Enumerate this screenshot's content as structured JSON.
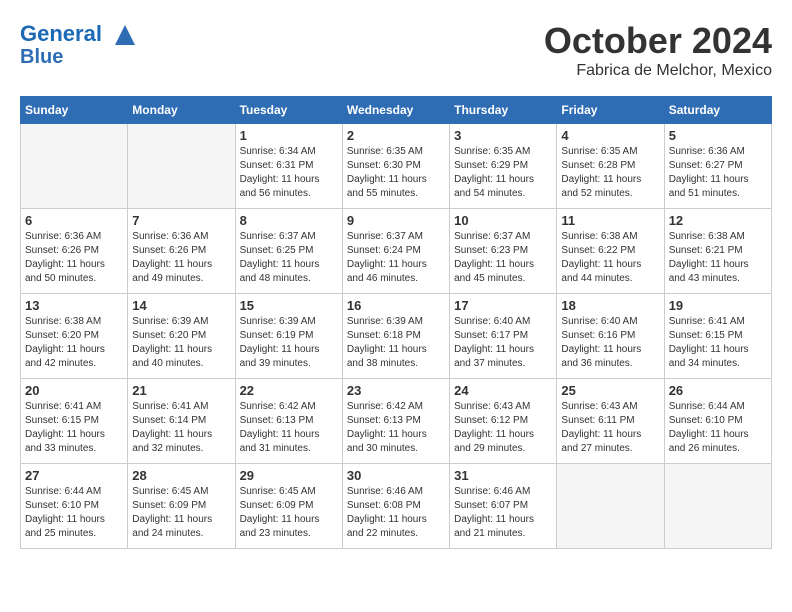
{
  "header": {
    "logo_line1": "General",
    "logo_line2": "Blue",
    "month": "October 2024",
    "location": "Fabrica de Melchor, Mexico"
  },
  "weekdays": [
    "Sunday",
    "Monday",
    "Tuesday",
    "Wednesday",
    "Thursday",
    "Friday",
    "Saturday"
  ],
  "weeks": [
    [
      {
        "day": "",
        "info": ""
      },
      {
        "day": "",
        "info": ""
      },
      {
        "day": "1",
        "info": "Sunrise: 6:34 AM\nSunset: 6:31 PM\nDaylight: 11 hours\nand 56 minutes."
      },
      {
        "day": "2",
        "info": "Sunrise: 6:35 AM\nSunset: 6:30 PM\nDaylight: 11 hours\nand 55 minutes."
      },
      {
        "day": "3",
        "info": "Sunrise: 6:35 AM\nSunset: 6:29 PM\nDaylight: 11 hours\nand 54 minutes."
      },
      {
        "day": "4",
        "info": "Sunrise: 6:35 AM\nSunset: 6:28 PM\nDaylight: 11 hours\nand 52 minutes."
      },
      {
        "day": "5",
        "info": "Sunrise: 6:36 AM\nSunset: 6:27 PM\nDaylight: 11 hours\nand 51 minutes."
      }
    ],
    [
      {
        "day": "6",
        "info": "Sunrise: 6:36 AM\nSunset: 6:26 PM\nDaylight: 11 hours\nand 50 minutes."
      },
      {
        "day": "7",
        "info": "Sunrise: 6:36 AM\nSunset: 6:26 PM\nDaylight: 11 hours\nand 49 minutes."
      },
      {
        "day": "8",
        "info": "Sunrise: 6:37 AM\nSunset: 6:25 PM\nDaylight: 11 hours\nand 48 minutes."
      },
      {
        "day": "9",
        "info": "Sunrise: 6:37 AM\nSunset: 6:24 PM\nDaylight: 11 hours\nand 46 minutes."
      },
      {
        "day": "10",
        "info": "Sunrise: 6:37 AM\nSunset: 6:23 PM\nDaylight: 11 hours\nand 45 minutes."
      },
      {
        "day": "11",
        "info": "Sunrise: 6:38 AM\nSunset: 6:22 PM\nDaylight: 11 hours\nand 44 minutes."
      },
      {
        "day": "12",
        "info": "Sunrise: 6:38 AM\nSunset: 6:21 PM\nDaylight: 11 hours\nand 43 minutes."
      }
    ],
    [
      {
        "day": "13",
        "info": "Sunrise: 6:38 AM\nSunset: 6:20 PM\nDaylight: 11 hours\nand 42 minutes."
      },
      {
        "day": "14",
        "info": "Sunrise: 6:39 AM\nSunset: 6:20 PM\nDaylight: 11 hours\nand 40 minutes."
      },
      {
        "day": "15",
        "info": "Sunrise: 6:39 AM\nSunset: 6:19 PM\nDaylight: 11 hours\nand 39 minutes."
      },
      {
        "day": "16",
        "info": "Sunrise: 6:39 AM\nSunset: 6:18 PM\nDaylight: 11 hours\nand 38 minutes."
      },
      {
        "day": "17",
        "info": "Sunrise: 6:40 AM\nSunset: 6:17 PM\nDaylight: 11 hours\nand 37 minutes."
      },
      {
        "day": "18",
        "info": "Sunrise: 6:40 AM\nSunset: 6:16 PM\nDaylight: 11 hours\nand 36 minutes."
      },
      {
        "day": "19",
        "info": "Sunrise: 6:41 AM\nSunset: 6:15 PM\nDaylight: 11 hours\nand 34 minutes."
      }
    ],
    [
      {
        "day": "20",
        "info": "Sunrise: 6:41 AM\nSunset: 6:15 PM\nDaylight: 11 hours\nand 33 minutes."
      },
      {
        "day": "21",
        "info": "Sunrise: 6:41 AM\nSunset: 6:14 PM\nDaylight: 11 hours\nand 32 minutes."
      },
      {
        "day": "22",
        "info": "Sunrise: 6:42 AM\nSunset: 6:13 PM\nDaylight: 11 hours\nand 31 minutes."
      },
      {
        "day": "23",
        "info": "Sunrise: 6:42 AM\nSunset: 6:13 PM\nDaylight: 11 hours\nand 30 minutes."
      },
      {
        "day": "24",
        "info": "Sunrise: 6:43 AM\nSunset: 6:12 PM\nDaylight: 11 hours\nand 29 minutes."
      },
      {
        "day": "25",
        "info": "Sunrise: 6:43 AM\nSunset: 6:11 PM\nDaylight: 11 hours\nand 27 minutes."
      },
      {
        "day": "26",
        "info": "Sunrise: 6:44 AM\nSunset: 6:10 PM\nDaylight: 11 hours\nand 26 minutes."
      }
    ],
    [
      {
        "day": "27",
        "info": "Sunrise: 6:44 AM\nSunset: 6:10 PM\nDaylight: 11 hours\nand 25 minutes."
      },
      {
        "day": "28",
        "info": "Sunrise: 6:45 AM\nSunset: 6:09 PM\nDaylight: 11 hours\nand 24 minutes."
      },
      {
        "day": "29",
        "info": "Sunrise: 6:45 AM\nSunset: 6:09 PM\nDaylight: 11 hours\nand 23 minutes."
      },
      {
        "day": "30",
        "info": "Sunrise: 6:46 AM\nSunset: 6:08 PM\nDaylight: 11 hours\nand 22 minutes."
      },
      {
        "day": "31",
        "info": "Sunrise: 6:46 AM\nSunset: 6:07 PM\nDaylight: 11 hours\nand 21 minutes."
      },
      {
        "day": "",
        "info": ""
      },
      {
        "day": "",
        "info": ""
      }
    ]
  ]
}
